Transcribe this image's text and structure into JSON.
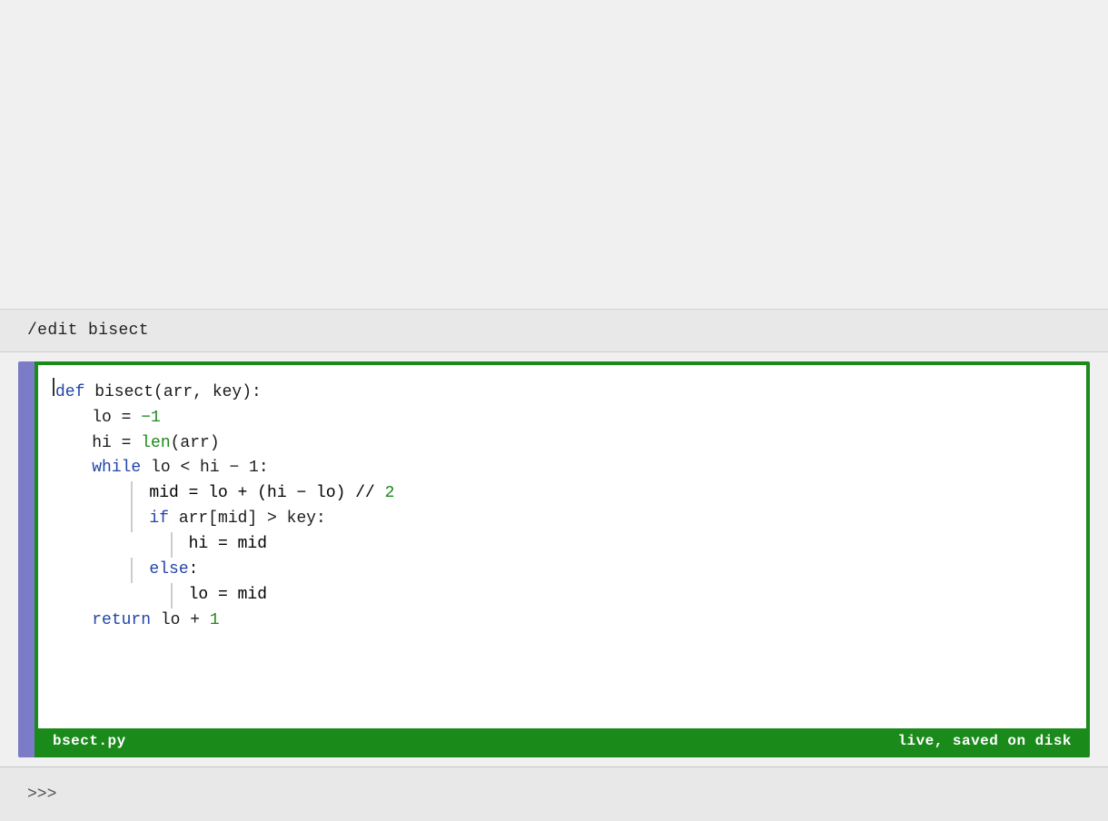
{
  "top_spacer_height": 340,
  "command_bar": {
    "text": "/edit bisect"
  },
  "editor": {
    "filename": "bsect.py",
    "status": "live, saved on disk",
    "code_lines": [
      {
        "id": "line1",
        "content": "def bisect(arr, key):"
      },
      {
        "id": "line2",
        "content": "    lo = -1"
      },
      {
        "id": "line3",
        "content": "    hi = len(arr)"
      },
      {
        "id": "line4",
        "content": "    while lo < hi - 1:"
      },
      {
        "id": "line5",
        "content": "        mid = lo + (hi - lo) // 2"
      },
      {
        "id": "line6",
        "content": "        if arr[mid] > key:"
      },
      {
        "id": "line7",
        "content": "            hi = mid"
      },
      {
        "id": "line8",
        "content": "        else:"
      },
      {
        "id": "line9",
        "content": "            lo = mid"
      },
      {
        "id": "line10",
        "content": "    return lo + 1"
      }
    ]
  },
  "repl": {
    "prompt": ">>>"
  }
}
